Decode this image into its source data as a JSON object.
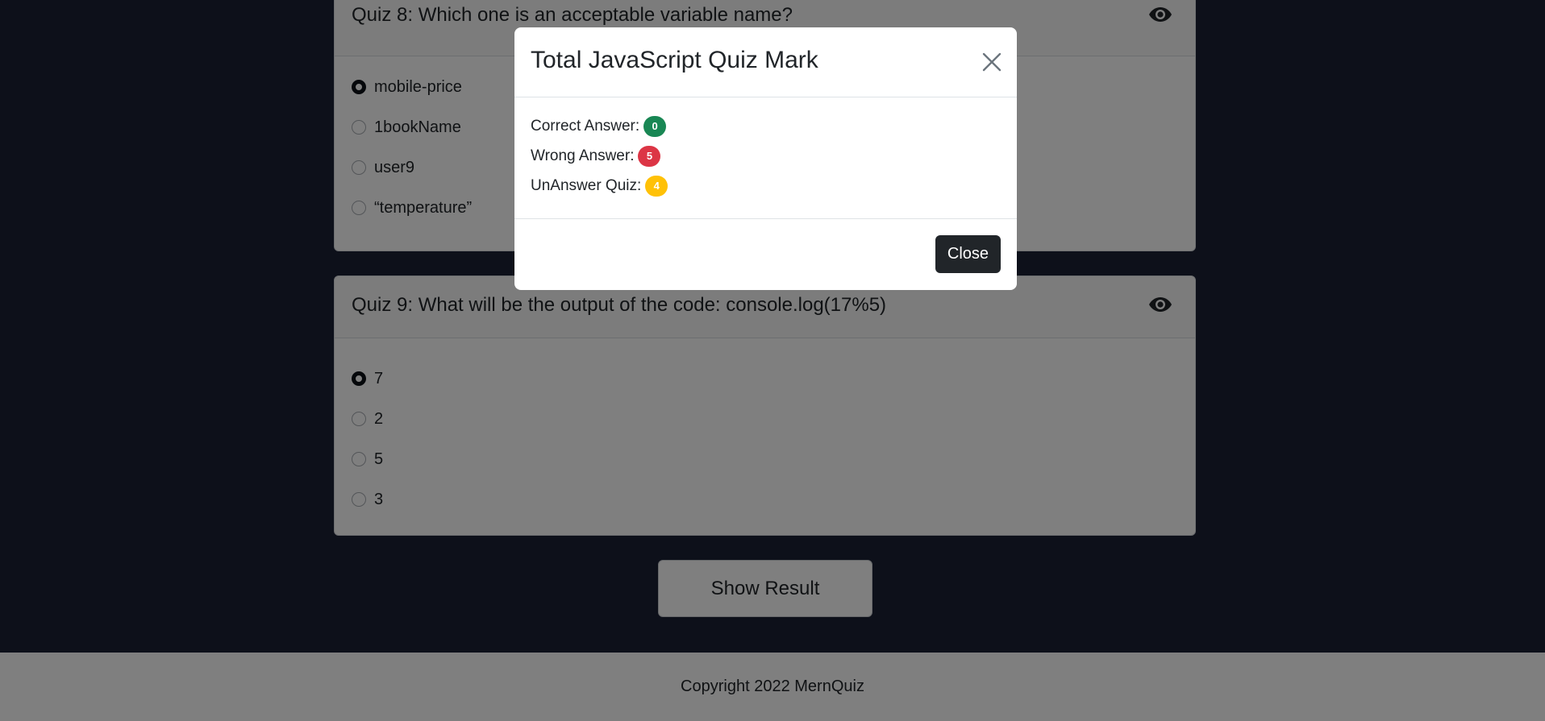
{
  "colors": {
    "page_background": "#1a2035",
    "correct_badge": "#198754",
    "wrong_badge": "#dc3545",
    "unanswered_badge": "#ffc107",
    "close_button": "#212529"
  },
  "quizzes": [
    {
      "title": "Quiz 8: Which one is an acceptable variable name?",
      "icon": "eye-icon",
      "options": [
        {
          "label": "mobile-price",
          "selected": true
        },
        {
          "label": "1bookName",
          "selected": false
        },
        {
          "label": "user9",
          "selected": false
        },
        {
          "label": "“temperature”",
          "selected": false
        }
      ]
    },
    {
      "title": "Quiz 9: What will be the output of the code: console.log(17%5)",
      "icon": "eye-icon",
      "options": [
        {
          "label": "7",
          "selected": true
        },
        {
          "label": "2",
          "selected": false
        },
        {
          "label": "5",
          "selected": false
        },
        {
          "label": "3",
          "selected": false
        }
      ]
    }
  ],
  "show_result_label": "Show Result",
  "footer": {
    "text": "Copyright 2022 MernQuiz"
  },
  "modal": {
    "title": "Total JavaScript Quiz Mark",
    "close_icon": "close-icon",
    "stats": [
      {
        "label": "Correct Answer:",
        "value": "0"
      },
      {
        "label": "Wrong Answer:",
        "value": "5"
      },
      {
        "label": "UnAnswer Quiz:",
        "value": "4"
      }
    ],
    "close_button_label": "Close"
  }
}
